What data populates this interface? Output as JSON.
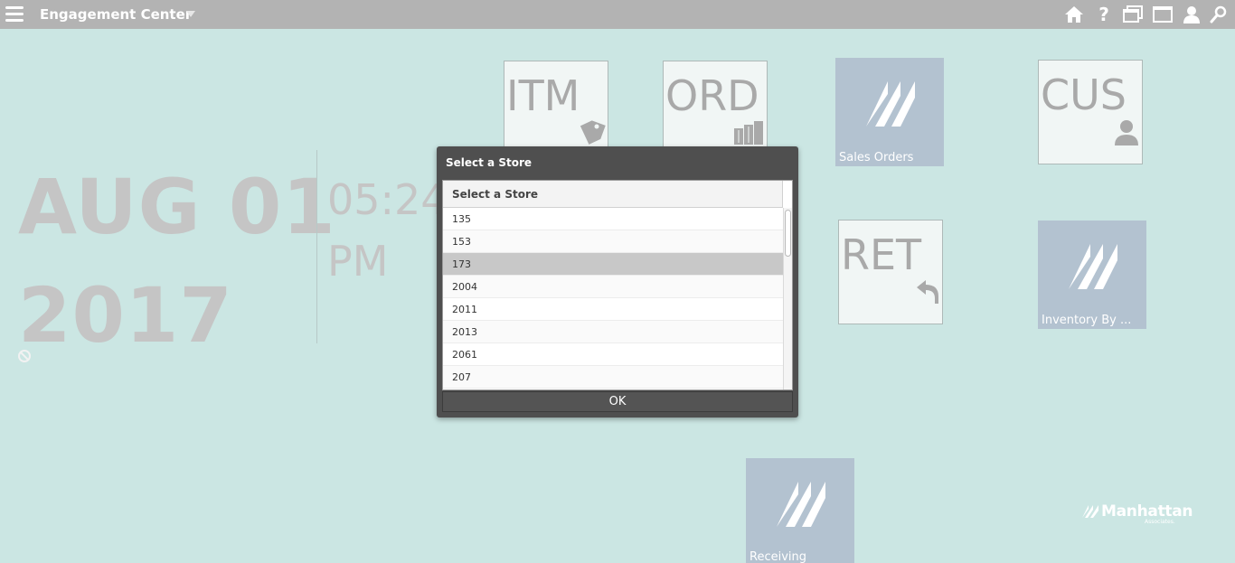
{
  "app": {
    "title": "Engagement Center"
  },
  "top_icons": [
    "home-icon",
    "help-icon",
    "windows-icon",
    "window-icon",
    "user-icon",
    "search-icon"
  ],
  "datetime": {
    "date_line1": "AUG 01",
    "date_line2": "2017",
    "time": "05:24",
    "ampm": "PM"
  },
  "tiles": {
    "itm": {
      "code": "ITM",
      "icon": "price-tag-icon"
    },
    "ord": {
      "code": "ORD",
      "icon": "boxes-icon"
    },
    "sales_orders": {
      "label": "Sales Orders",
      "icon": "manhattan-logo-icon"
    },
    "cus": {
      "code": "CUS",
      "icon": "person-icon"
    },
    "ret": {
      "code": "RET",
      "icon": "return-arrow-icon"
    },
    "inventory": {
      "label": "Inventory By ...",
      "icon": "manhattan-logo-icon"
    },
    "receiving": {
      "label": "Receiving",
      "icon": "manhattan-logo-icon"
    }
  },
  "dialog": {
    "title": "Select a Store",
    "column_header": "Select a Store",
    "stores": [
      "135",
      "153",
      "173",
      "2004",
      "2011",
      "2013",
      "2061",
      "207"
    ],
    "selected_store": "173",
    "ok_label": "OK"
  },
  "brand": {
    "name": "Manhattan",
    "sub": "Associates."
  },
  "colors": {
    "background": "#cbe6e3",
    "topbar": "#b3b3b3",
    "tile_blue": "#b3c2d0",
    "dialog": "#4f4f4f",
    "selected_row": "#c8c8c8"
  }
}
